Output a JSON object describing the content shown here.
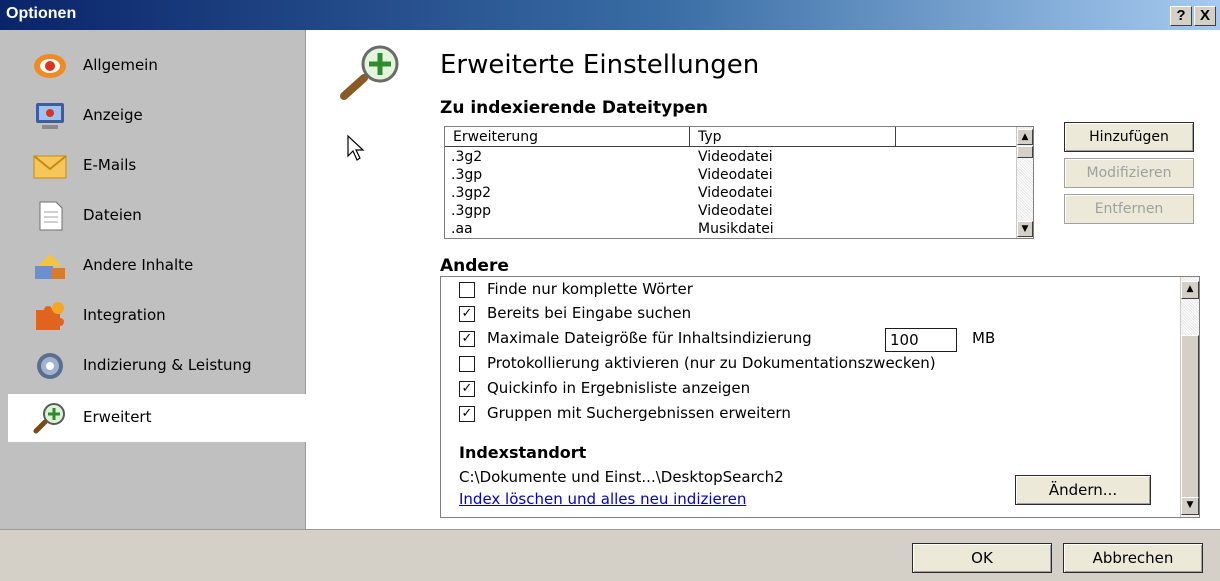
{
  "window": {
    "title": "Optionen",
    "help_label": "?",
    "close_label": "X"
  },
  "sidebar": {
    "items": [
      {
        "label": "Allgemein",
        "icon": "general-icon"
      },
      {
        "label": "Anzeige",
        "icon": "display-icon"
      },
      {
        "label": "E-Mails",
        "icon": "mail-icon"
      },
      {
        "label": "Dateien",
        "icon": "file-icon"
      },
      {
        "label": "Andere Inhalte",
        "icon": "other-content-icon"
      },
      {
        "label": "Integration",
        "icon": "puzzle-icon"
      },
      {
        "label": "Indizierung & Leistung",
        "icon": "gear-icon"
      },
      {
        "label": "Erweitert",
        "icon": "magnifier-plus-icon",
        "active": true
      }
    ]
  },
  "main": {
    "heading": "Erweiterte Einstellungen",
    "filetypes": {
      "title": "Zu indexierende Dateitypen",
      "columns": [
        "Erweiterung",
        "Typ",
        ""
      ],
      "rows": [
        {
          "ext": ".3g2",
          "type": "Videodatei"
        },
        {
          "ext": ".3gp",
          "type": "Videodatei"
        },
        {
          "ext": ".3gp2",
          "type": "Videodatei"
        },
        {
          "ext": ".3gpp",
          "type": "Videodatei"
        },
        {
          "ext": ".aa",
          "type": "Musikdatei"
        }
      ],
      "buttons": {
        "add": "Hinzufügen",
        "modify": "Modifizieren",
        "remove": "Entfernen"
      }
    },
    "other": {
      "title": "Andere",
      "options": [
        {
          "label": "Finde nur komplette Wörter",
          "checked": false
        },
        {
          "label": "Bereits bei Eingabe suchen",
          "checked": true
        },
        {
          "label": "Maximale Dateigröße für Inhaltsindizierung",
          "checked": true
        },
        {
          "label": "Protokollierung aktivieren (nur zu Dokumentationszwecken)",
          "checked": false
        },
        {
          "label": "Quickinfo in Ergebnisliste anzeigen",
          "checked": true
        },
        {
          "label": "Gruppen mit Suchergebnissen erweitern",
          "checked": true
        }
      ],
      "max_size_value": "100",
      "max_size_unit": "MB",
      "index_location": {
        "title": "Indexstandort",
        "path": "C:\\Dokumente und Einst...\\DesktopSearch2",
        "reindex_link": "Index löschen und alles neu indizieren",
        "change_button": "Ändern..."
      }
    }
  },
  "footer": {
    "ok": "OK",
    "cancel": "Abbrechen"
  }
}
